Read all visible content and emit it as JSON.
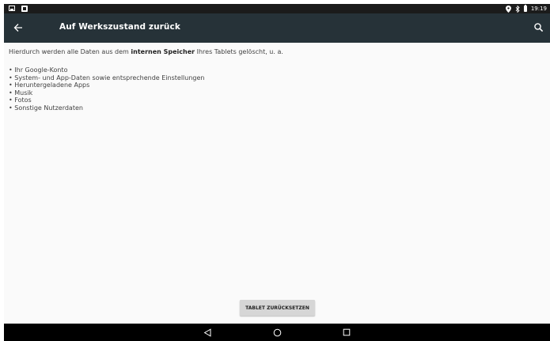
{
  "status_bar": {
    "left_icons": [
      "photo-notification-icon",
      "android-notification-icon"
    ],
    "right_icons": [
      "location-icon",
      "bluetooth-icon",
      "battery-icon"
    ],
    "time": "19:19"
  },
  "app_bar": {
    "title": "Auf Werkszustand zurück",
    "back_icon": "arrow-back-icon",
    "search_icon": "search-icon",
    "background": "#263238"
  },
  "content": {
    "intro_before": "Hierdurch werden alle Daten aus dem ",
    "intro_bold": "internen Speicher",
    "intro_after": " Ihres Tablets gelöscht, u. a.",
    "items": [
      "• Ihr Google-Konto",
      "• System- und App-Daten sowie entsprechende Einstellungen",
      "• Heruntergeladene Apps",
      "• Musik",
      "• Fotos",
      "• Sonstige Nutzerdaten"
    ]
  },
  "reset_button": {
    "label": "TABLET ZURÜCKSETZEN"
  },
  "nav_bar": {
    "icons": [
      "back-triangle-icon",
      "home-circle-icon",
      "recents-square-icon"
    ]
  }
}
